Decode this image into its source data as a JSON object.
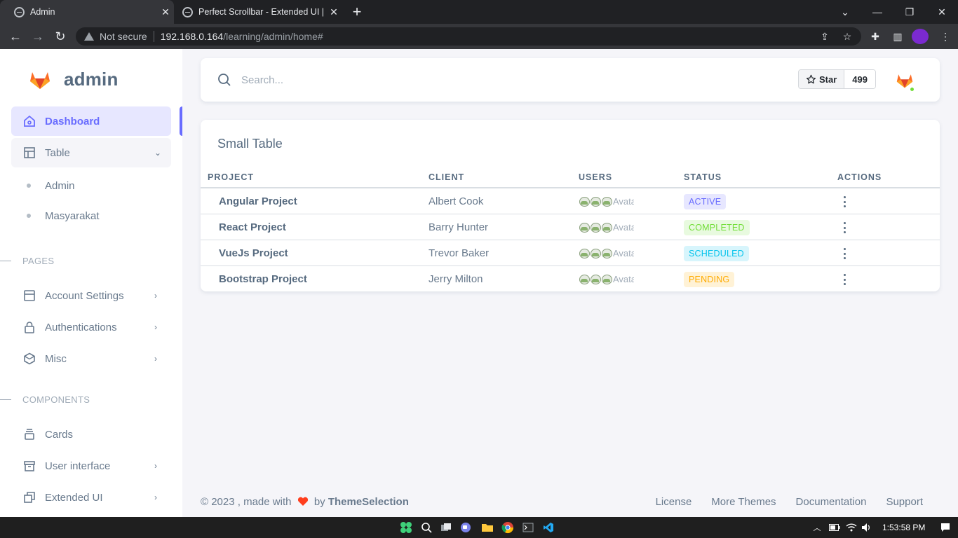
{
  "browser": {
    "tabs": [
      {
        "title": "Admin",
        "active": true
      },
      {
        "title": "Perfect Scrollbar - Extended UI | S",
        "active": false
      }
    ],
    "security_label": "Not secure",
    "url_host": "192.168.0.164",
    "url_path": "/learning/admin/home#"
  },
  "sidebar": {
    "brand": "admin",
    "items": [
      {
        "label": "Dashboard",
        "icon": "home-icon"
      },
      {
        "label": "Table",
        "icon": "table-icon"
      }
    ],
    "table_subitems": [
      "Admin",
      "Masyarakat"
    ],
    "pages_header": "PAGES",
    "pages_items": [
      {
        "label": "Account Settings",
        "icon": "window-icon"
      },
      {
        "label": "Authentications",
        "icon": "lock-icon"
      },
      {
        "label": "Misc",
        "icon": "cube-icon"
      }
    ],
    "components_header": "COMPONENTS",
    "components_items": [
      {
        "label": "Cards",
        "icon": "collection-icon"
      },
      {
        "label": "User interface",
        "icon": "box-icon"
      },
      {
        "label": "Extended UI",
        "icon": "copy-icon"
      }
    ]
  },
  "navbar": {
    "search_placeholder": "Search...",
    "star_label": "Star",
    "star_count": "499"
  },
  "table": {
    "title": "Small Table",
    "columns": [
      "PROJECT",
      "CLIENT",
      "USERS",
      "STATUS",
      "ACTIONS"
    ],
    "avatar_alt": "Avatar",
    "rows": [
      {
        "project": "Angular Project",
        "client": "Albert Cook",
        "status": "ACTIVE"
      },
      {
        "project": "React Project",
        "client": "Barry Hunter",
        "status": "COMPLETED"
      },
      {
        "project": "VueJs Project",
        "client": "Trevor Baker",
        "status": "SCHEDULED"
      },
      {
        "project": "Bootstrap Project",
        "client": "Jerry Milton",
        "status": "PENDING"
      }
    ]
  },
  "status_colors": {
    "ACTIVE": {
      "bg": "#e7e7ff",
      "fg": "#696cff"
    },
    "COMPLETED": {
      "bg": "#e8fadf",
      "fg": "#71dd37"
    },
    "SCHEDULED": {
      "bg": "#d7f5fc",
      "fg": "#03c3ec"
    },
    "PENDING": {
      "bg": "#fff2d6",
      "fg": "#ffab00"
    }
  },
  "footer": {
    "copyright": "© 2023 , made with",
    "by": "by",
    "brand": "ThemeSelection",
    "links": [
      "License",
      "More Themes",
      "Documentation",
      "Support"
    ]
  },
  "taskbar": {
    "time": "1:53:58 PM"
  },
  "colors": {
    "accent": "#696cff",
    "heart": "#ff3e1d"
  }
}
